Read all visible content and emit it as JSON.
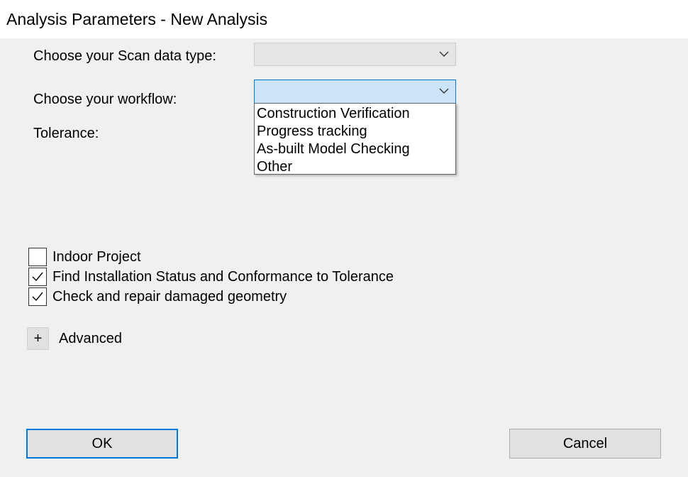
{
  "window": {
    "title": "Analysis Parameters - New Analysis"
  },
  "form": {
    "scan_data_type_label": "Choose your Scan data type:",
    "scan_data_type_value": "",
    "workflow_label": "Choose your workflow:",
    "workflow_value": "",
    "tolerance_label": "Tolerance:"
  },
  "workflow_options": [
    "Construction Verification",
    "Progress tracking",
    "As-built Model Checking",
    "Other"
  ],
  "checkboxes": [
    {
      "label": "Indoor Project",
      "checked": false
    },
    {
      "label": "Find Installation Status and Conformance to Tolerance",
      "checked": true
    },
    {
      "label": "Check and repair damaged geometry",
      "checked": true
    }
  ],
  "advanced": {
    "toggle_symbol": "+",
    "label": "Advanced"
  },
  "buttons": {
    "ok": "OK",
    "cancel": "Cancel"
  },
  "colors": {
    "accent": "#0078d7",
    "dropdown_active_bg": "#cce4f7",
    "window_bg": "#f0f0f0"
  },
  "icons": {
    "combo_chevron": "chevron-down-icon",
    "check": "checkmark-icon"
  }
}
